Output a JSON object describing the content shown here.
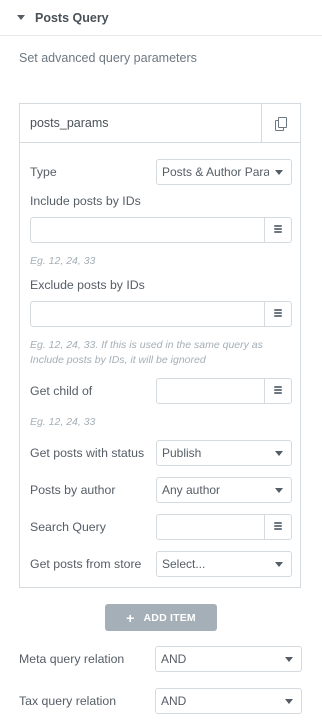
{
  "section": {
    "title": "Posts Query",
    "description": "Set advanced query parameters"
  },
  "repeater": {
    "item_title": "posts_params",
    "fields": {
      "type_label": "Type",
      "type_value": "Posts & Author Params",
      "include_label": "Include posts by IDs",
      "include_value": "",
      "include_hint": "Eg. 12, 24, 33",
      "exclude_label": "Exclude posts by IDs",
      "exclude_value": "",
      "exclude_hint_1": "Eg. 12, 24, 33. If this is used in the same query as",
      "exclude_hint_2": "Include posts by IDs, it will be ignored",
      "child_label": "Get child of",
      "child_value": "",
      "child_hint": "Eg. 12, 24, 33",
      "status_label": "Get posts with status",
      "status_value": "Publish",
      "author_label": "Posts by author",
      "author_value": "Any author",
      "search_label": "Search Query",
      "search_value": "",
      "store_label": "Get posts from store",
      "store_value": "Select..."
    }
  },
  "add_item": {
    "plus": "+",
    "label": "ADD ITEM"
  },
  "meta_query": {
    "label": "Meta query relation",
    "value": "AND"
  },
  "tax_query": {
    "label": "Tax query relation",
    "value": "AND"
  }
}
